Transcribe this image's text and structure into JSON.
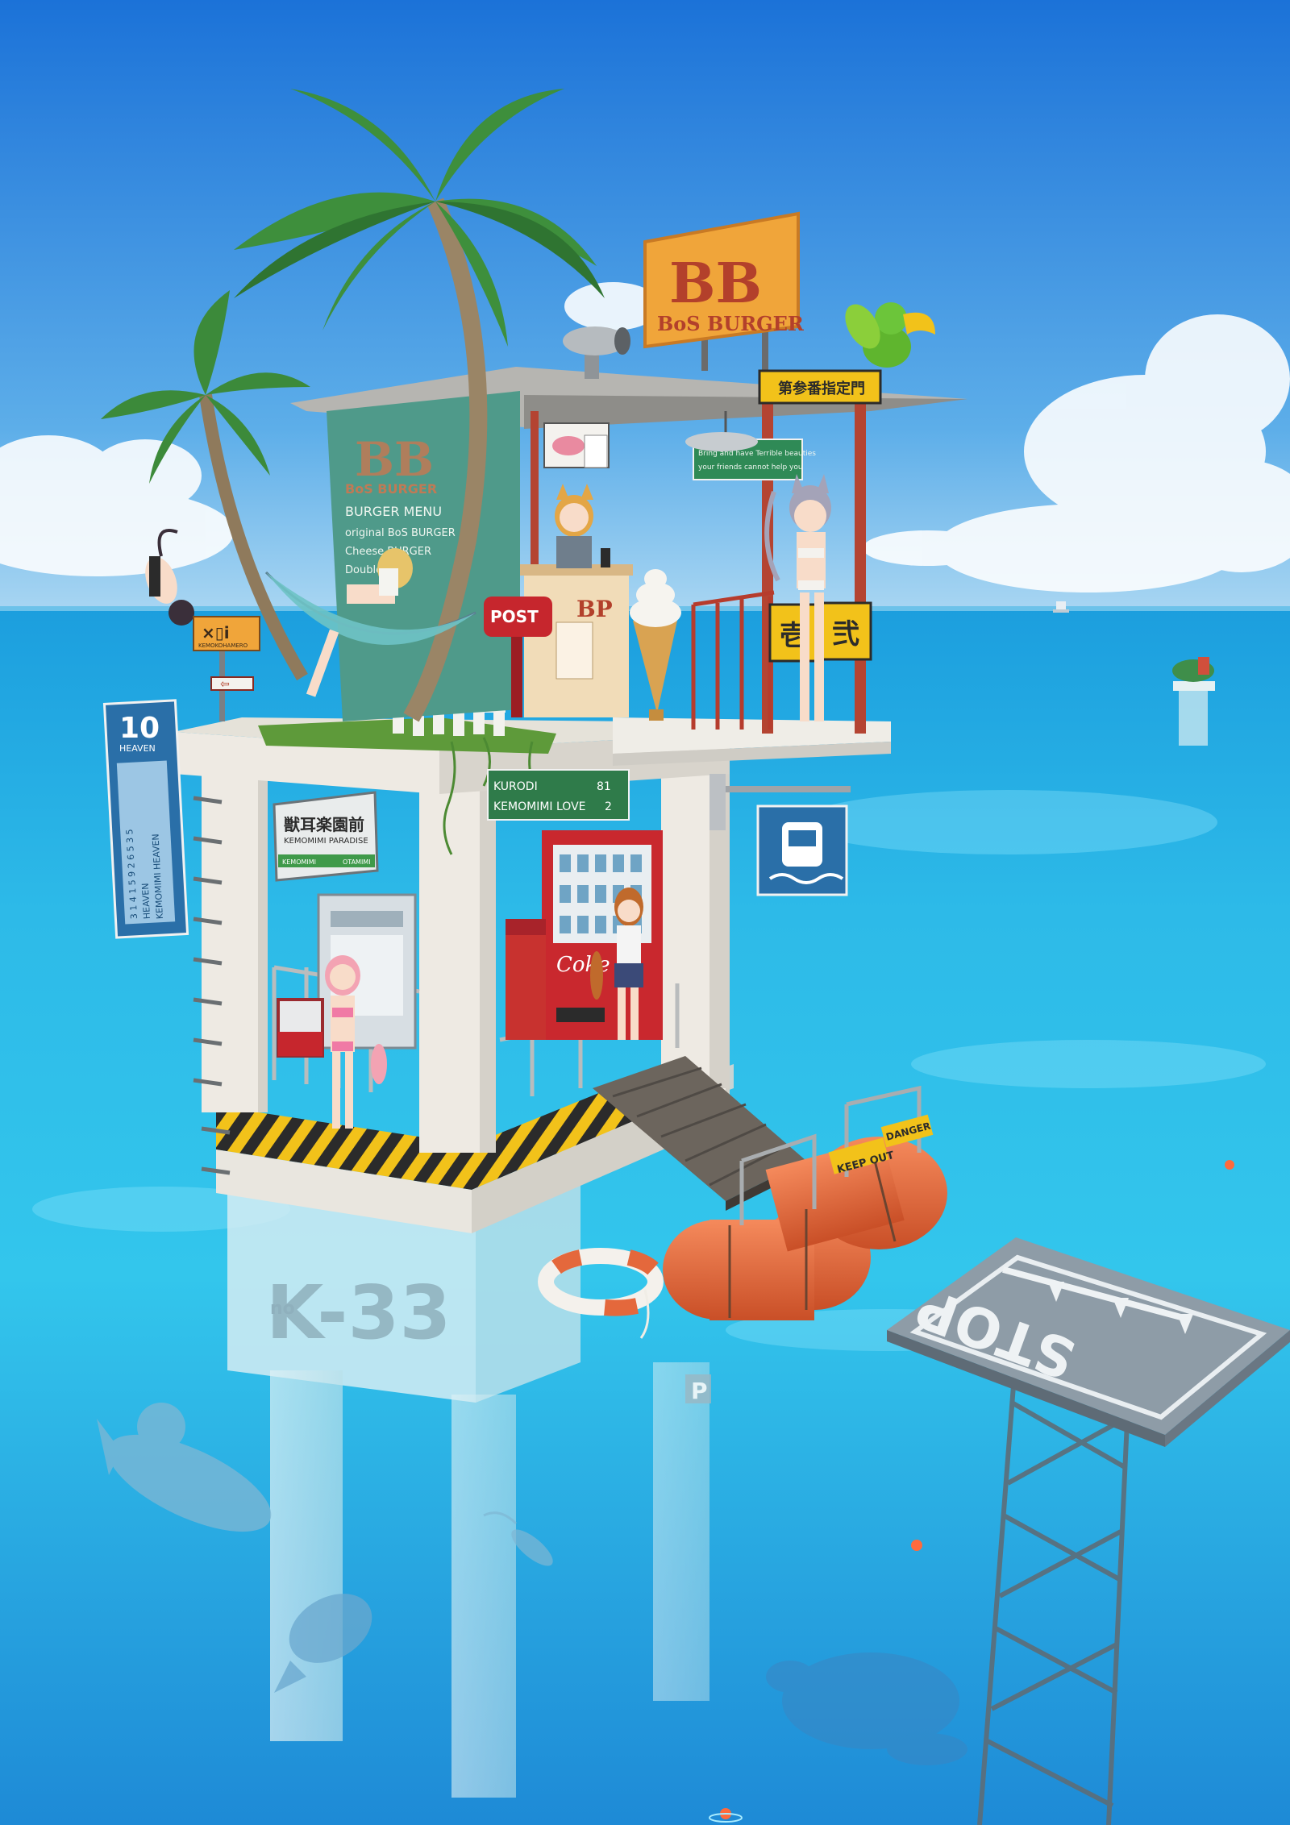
{
  "billboard": {
    "logo": "BB",
    "name": "BoS BURGER"
  },
  "banner": {
    "logo": "BB",
    "name": "BoS BURGER",
    "menu_title": "BURGER MENU",
    "menu_items": [
      "original BoS BURGER",
      "Cheese BURGER",
      "Double"
    ]
  },
  "counter": {
    "logo": "BP"
  },
  "mailbox": {
    "label": "POST"
  },
  "island_sign": {
    "glyphs": "×▯i",
    "caption": "KEMOKOHAMERO"
  },
  "warning_panels": [
    "壱",
    "弐"
  ],
  "hanging_sign": {
    "line1": "Bring and have Terrible beauties",
    "line2": "your friends cannot help you"
  },
  "roof_plate": "第参番指定門",
  "tower_sign_jp": {
    "title": "獣耳楽園前",
    "subtitle": "KEMOMIMI PARADISE",
    "left": "KEMOMIMI",
    "right": "OTAMIMI"
  },
  "route_sign": [
    {
      "text": "KURODI",
      "num": "81"
    },
    {
      "text": "KEMOMIMI LOVE",
      "num": "2"
    }
  ],
  "vertical_sign": {
    "number": "10",
    "sub": "HEAVEN",
    "lines": [
      "3 1 4 1 5 9 2 6 5 3 5",
      "HEAVEN",
      "KEMOMIMI HEAVEN"
    ]
  },
  "vending": {
    "brand": "Coke"
  },
  "pillar": {
    "code": "K-33",
    "sub": "no",
    "parking": "P"
  },
  "stop_platform": {
    "text": "STOP"
  },
  "pontoon_signs": [
    "KEEP OUT",
    "DANGER"
  ],
  "colors": {
    "sky_top": "#1b72d8",
    "sky_bottom": "#a9d6f2",
    "sea_horizon": "#19a2de",
    "sea_mid": "#2fc4ec",
    "sea_bottom": "#1e8ad6",
    "concrete": "#eeeae3",
    "hazard_yellow": "#f2c21a",
    "bb_orange": "#f0a53a",
    "bb_red": "#b3402b",
    "banner_green": "#4f9a8a",
    "float_orange": "#e4683c",
    "post_red": "#c6262d"
  }
}
